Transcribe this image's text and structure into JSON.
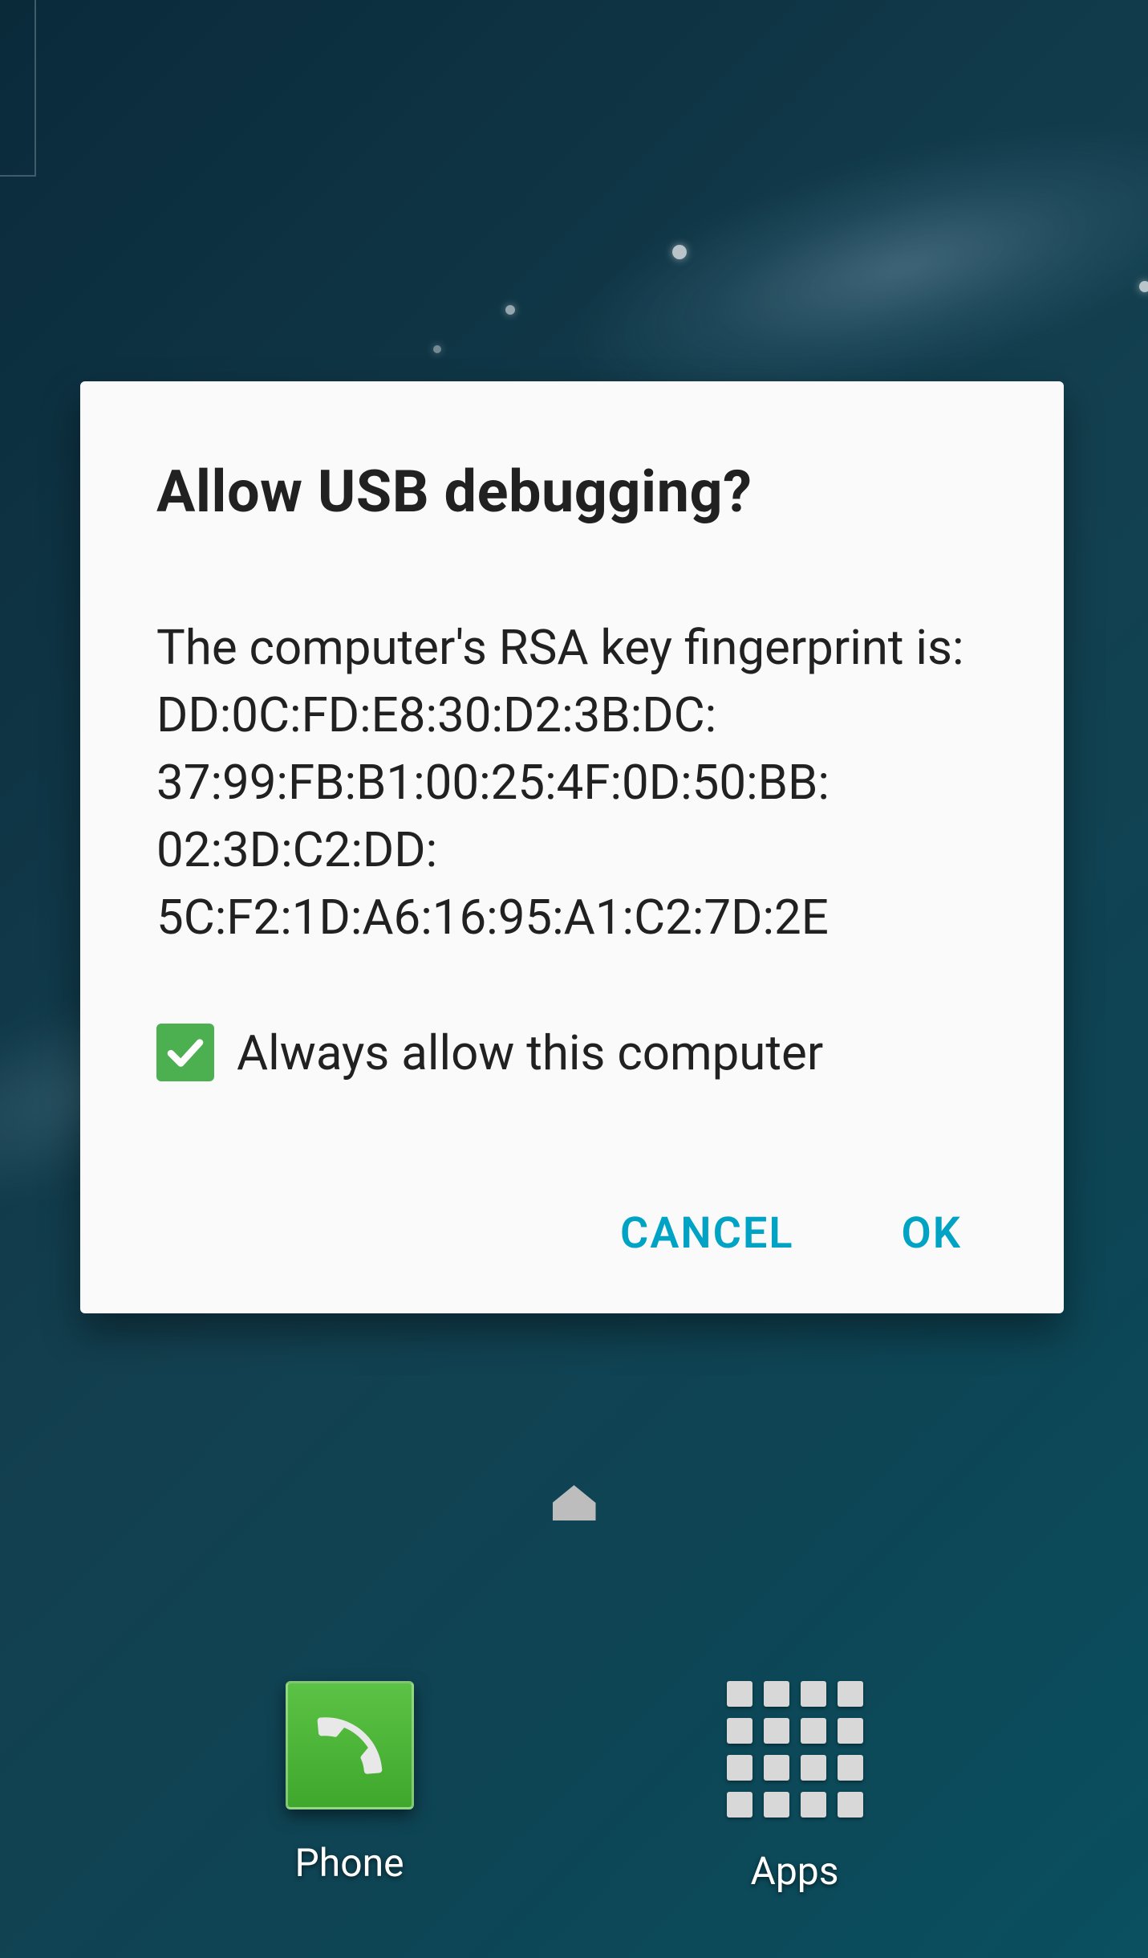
{
  "dialog": {
    "title": "Allow USB debugging?",
    "body": "The computer's RSA key fingerprint is:\nDD:0C:FD:E8:30:D2:3B:DC:\n37:99:FB:B1:00:25:4F:0D:50:BB:\n02:3D:C2:DD:\n5C:F2:1D:A6:16:95:A1:C2:7D:2E",
    "checkbox_label": "Always allow this computer",
    "checkbox_checked": true,
    "actions": {
      "cancel": "CANCEL",
      "ok": "OK"
    }
  },
  "dock": {
    "items": [
      {
        "label": "Phone",
        "icon": "phone-icon"
      },
      {
        "label": "Apps",
        "icon": "apps-icon"
      }
    ]
  }
}
